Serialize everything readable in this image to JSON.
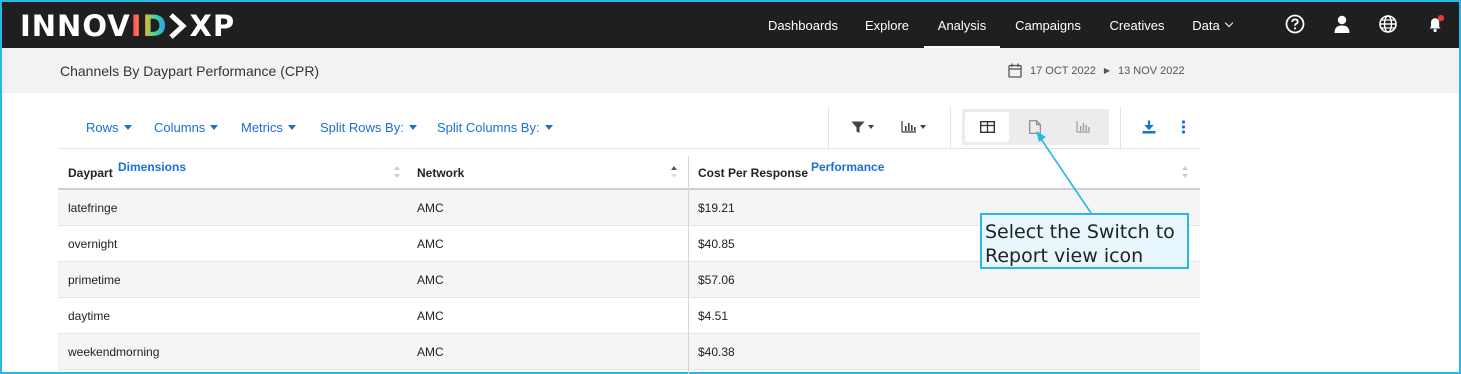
{
  "app": {
    "logo_left": "INNOV",
    "logo_mid": "ID",
    "logo_right": "XP"
  },
  "nav": {
    "items": [
      {
        "label": "Dashboards",
        "active": false
      },
      {
        "label": "Explore",
        "active": false
      },
      {
        "label": "Analysis",
        "active": true
      },
      {
        "label": "Campaigns",
        "active": false
      },
      {
        "label": "Creatives",
        "active": false
      },
      {
        "label": "Data",
        "active": false
      }
    ],
    "icons": [
      "help-icon",
      "user-icon",
      "globe-icon",
      "notification-bell-icon"
    ],
    "notification_dot_color": "#e53935"
  },
  "header": {
    "title": "Channels By Daypart Performance (CPR)",
    "date_start": "17 OCT 2022",
    "date_end": "13 NOV 2022"
  },
  "toolbar": {
    "rows_label": "Rows",
    "columns_label": "Columns",
    "metrics_label": "Metrics",
    "split_rows_label": "Split Rows By:",
    "split_columns_label": "Split Columns By:",
    "icons": [
      "filter-icon",
      "chart-options-icon",
      "table-view-icon",
      "report-view-icon",
      "chart-view-icon",
      "download-icon",
      "more-options-icon"
    ],
    "accent_color": "#1a6fd6"
  },
  "table": {
    "group_dimensions": "Dimensions",
    "group_performance": "Performance",
    "columns": [
      "Daypart",
      "Network",
      "Cost Per Response"
    ],
    "rows": [
      [
        "latefringe",
        "AMC",
        "$19.21"
      ],
      [
        "overnight",
        "AMC",
        "$40.85"
      ],
      [
        "primetime",
        "AMC",
        "$57.06"
      ],
      [
        "daytime",
        "AMC",
        "$4.51"
      ],
      [
        "weekendmorning",
        "AMC",
        "$40.38"
      ]
    ]
  },
  "callout": {
    "text_line1": "Select the Switch to",
    "text_line2": "Report view icon",
    "border_color": "#29b6e8"
  }
}
